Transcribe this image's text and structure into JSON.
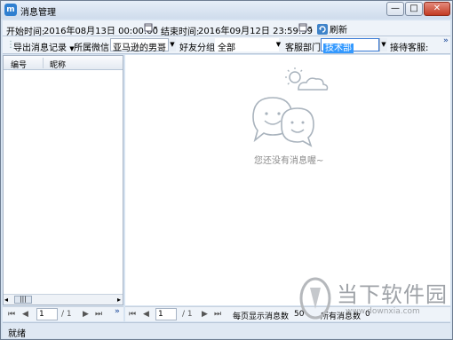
{
  "window": {
    "title": "消息管理",
    "app_icon_char": "m",
    "minimize_glyph": "—",
    "maximize_glyph": "□",
    "close_glyph": "✕"
  },
  "filter_bar": {
    "start_label": "开始时间:",
    "start_value": "2016年08月13日  00:00:00",
    "end_label": "结束时间:",
    "end_value": "2016年09月12日  23:59:59",
    "refresh_label": "刷新"
  },
  "options_bar": {
    "export_label": "导出消息记录",
    "wechat_label": "所属微信:",
    "wechat_value": "亚马逊的男哥",
    "group_label": "好友分组:",
    "group_value": "全部",
    "dept_label": "客服部门:",
    "dept_value": "技术部",
    "agent_label": "接待客服:",
    "more_glyph": "»"
  },
  "left_table": {
    "columns": [
      "编号",
      "昵称"
    ],
    "scroll_thumb_glyph": "|||"
  },
  "empty_state": {
    "message": "您还没有消息喔~"
  },
  "left_pager": {
    "page_value": "1",
    "total": "/ 1",
    "more_glyph": "»"
  },
  "right_pager": {
    "page_value": "1",
    "total": "/ 1",
    "per_page_label": "每页显示消息数",
    "per_page_value": "50",
    "all_messages_label": "所有消息数",
    "all_messages_value": "0"
  },
  "status": {
    "text": "就绪"
  },
  "watermark": {
    "text": "当下软件园",
    "url": "www.downxia.com"
  },
  "colors": {
    "accent": "#2f7fd0",
    "dept_highlight": "#3399ff"
  }
}
